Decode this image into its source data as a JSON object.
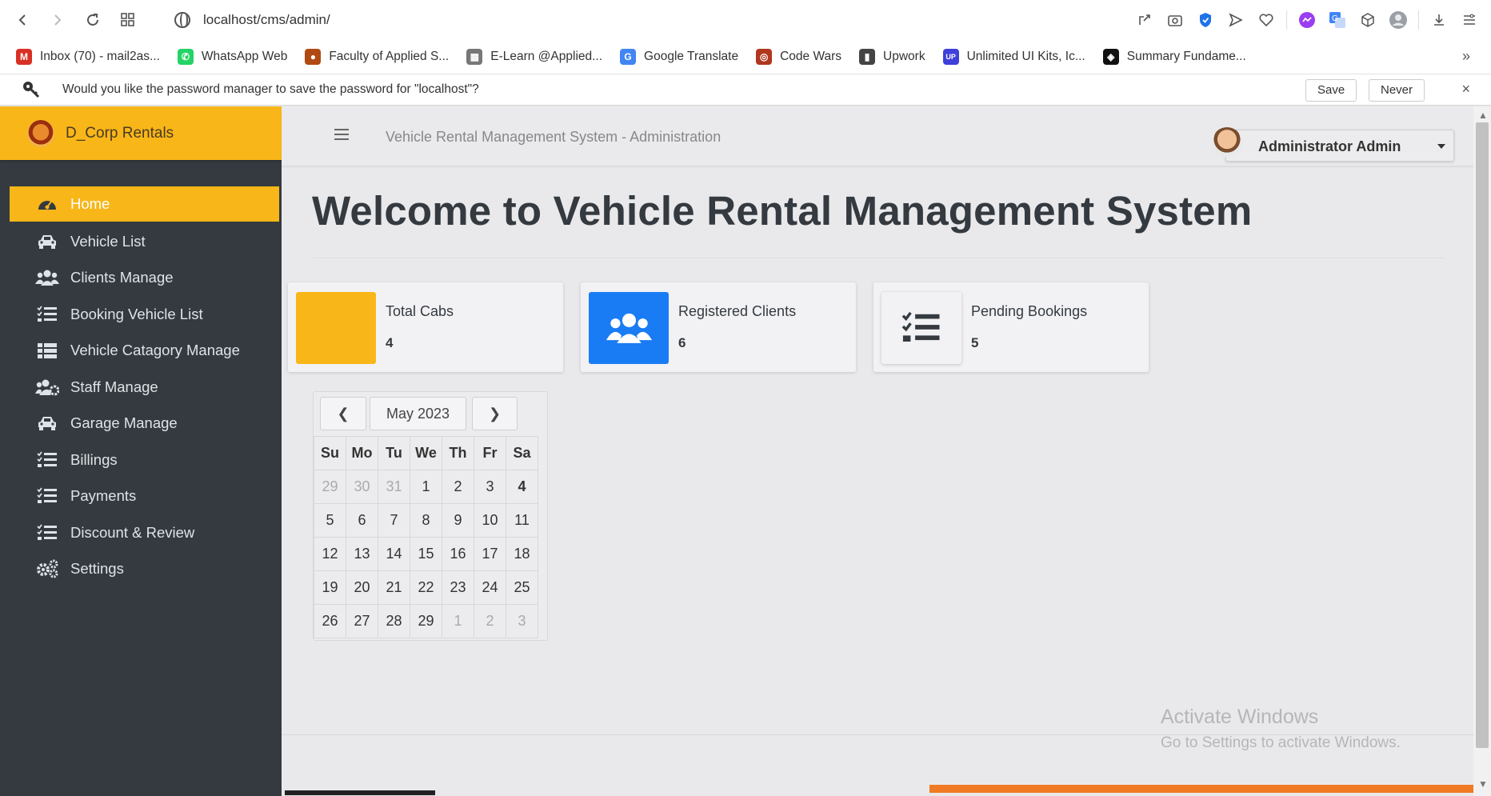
{
  "browser": {
    "url": "localhost/cms/admin/",
    "bookmarks": [
      {
        "label": "Inbox (70) - mail2as...",
        "icon": "gmail-icon",
        "color": "#d93025",
        "glyph": "M"
      },
      {
        "label": "WhatsApp Web",
        "icon": "whatsapp-icon",
        "color": "#25d366",
        "glyph": "✆"
      },
      {
        "label": "Faculty of Applied S...",
        "icon": "faculty-icon",
        "color": "#b04a12",
        "glyph": "●"
      },
      {
        "label": "E-Learn @Applied...",
        "icon": "elearn-icon",
        "color": "#777777",
        "glyph": "▦"
      },
      {
        "label": "Google Translate",
        "icon": "google-translate-icon",
        "color": "#4285f4",
        "glyph": "G"
      },
      {
        "label": "Code Wars",
        "icon": "codewars-icon",
        "color": "#b1361e",
        "glyph": "◎"
      },
      {
        "label": "Upwork",
        "icon": "document-icon",
        "color": "#444444",
        "glyph": "▮"
      },
      {
        "label": "Unlimited UI Kits, Ic...",
        "icon": "uikits-icon",
        "color": "#3f3fd9",
        "glyph": "UP"
      },
      {
        "label": "Summary Fundame...",
        "icon": "summary-icon",
        "color": "#111111",
        "glyph": "◈"
      }
    ],
    "password_bar": {
      "message": "Would you like the password manager to save the password for \"localhost\"?",
      "save_label": "Save",
      "never_label": "Never",
      "close_glyph": "×"
    }
  },
  "sidebar": {
    "brand": "D_Corp Rentals",
    "items": [
      {
        "label": "Home",
        "icon": "dashboard-icon",
        "active": true
      },
      {
        "label": "Vehicle List",
        "icon": "car-icon"
      },
      {
        "label": "Clients Manage",
        "icon": "users-icon"
      },
      {
        "label": "Booking Vehicle List",
        "icon": "list-icon"
      },
      {
        "label": "Vehicle Catagory Manage",
        "icon": "table-icon"
      },
      {
        "label": "Staff Manage",
        "icon": "users-cog-icon"
      },
      {
        "label": "Garage Manage",
        "icon": "car-icon"
      },
      {
        "label": "Billings",
        "icon": "list-icon"
      },
      {
        "label": "Payments",
        "icon": "list-icon"
      },
      {
        "label": "Discount & Review",
        "icon": "list-icon"
      },
      {
        "label": "Settings",
        "icon": "cogs-icon"
      }
    ]
  },
  "header": {
    "title": "Vehicle Rental Management System - Administration",
    "user": "Administrator Admin"
  },
  "main": {
    "heading": "Welcome to Vehicle Rental Management System",
    "cards": [
      {
        "label": "Total Cabs",
        "value": "4",
        "icon": "car-icon",
        "color": "#f8b619"
      },
      {
        "label": "Registered Clients",
        "value": "6",
        "icon": "users-icon",
        "color": "#1a7cf5"
      },
      {
        "label": "Pending Bookings",
        "value": "5",
        "icon": "list-icon",
        "color": "#f2f2f4"
      }
    ],
    "calendar": {
      "month": "May 2023",
      "prev_glyph": "❮",
      "next_glyph": "❯",
      "weekdays": [
        "Su",
        "Mo",
        "Tu",
        "We",
        "Th",
        "Fr",
        "Sa"
      ],
      "weeks": [
        [
          "29",
          "30",
          "31",
          "1",
          "2",
          "3",
          "4"
        ],
        [
          "5",
          "6",
          "7",
          "8",
          "9",
          "10",
          "11"
        ],
        [
          "12",
          "13",
          "14",
          "15",
          "16",
          "17",
          "18"
        ],
        [
          "19",
          "20",
          "21",
          "22",
          "23",
          "24",
          "25"
        ],
        [
          "26",
          "27",
          "28",
          "29",
          "1",
          "2",
          "3"
        ]
      ]
    }
  },
  "watermark": {
    "line1": "Activate Windows",
    "line2": "Go to Settings to activate Windows."
  },
  "progress_percent": 37
}
